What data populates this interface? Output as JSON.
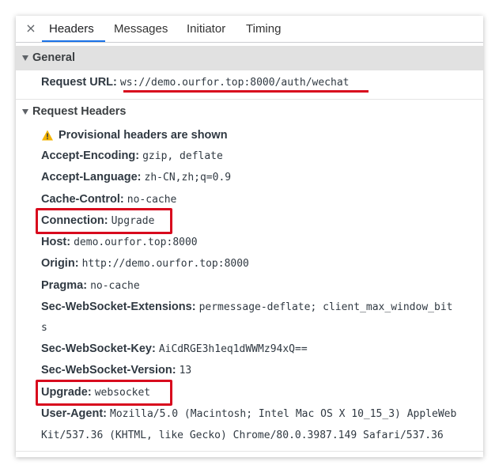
{
  "tabs": [
    {
      "label": "Headers"
    },
    {
      "label": "Messages"
    },
    {
      "label": "Initiator"
    },
    {
      "label": "Timing"
    }
  ],
  "close_symbol": "×",
  "general": {
    "title": "General",
    "request_url_label": "Request URL:",
    "request_url_value": "ws://demo.ourfor.top:8000/auth/wechat"
  },
  "request_headers": {
    "title": "Request Headers",
    "warning": "Provisional headers are shown",
    "warning_icon": "warning-triangle-icon",
    "items": [
      {
        "name": "Accept-Encoding:",
        "value": "gzip, deflate"
      },
      {
        "name": "Accept-Language:",
        "value": "zh-CN,zh;q=0.9"
      },
      {
        "name": "Cache-Control:",
        "value": "no-cache"
      },
      {
        "name": "Connection:",
        "value": "Upgrade"
      },
      {
        "name": "Host:",
        "value": "demo.ourfor.top:8000"
      },
      {
        "name": "Origin:",
        "value": "http://demo.ourfor.top:8000"
      },
      {
        "name": "Pragma:",
        "value": "no-cache"
      },
      {
        "name": "Sec-WebSocket-Extensions:",
        "value": "permessage-deflate; client_max_window_bit",
        "value_cont": "s"
      },
      {
        "name": "Sec-WebSocket-Key:",
        "value": "AiCdRGE3h1eq1dWWMz94xQ=="
      },
      {
        "name": "Sec-WebSocket-Version:",
        "value": "13"
      },
      {
        "name": "Upgrade:",
        "value": "websocket"
      },
      {
        "name": "User-Agent:",
        "value": "Mozilla/5.0 (Macintosh; Intel Mac OS X 10_15_3) AppleWeb",
        "value_cont": "Kit/537.36 (KHTML, like Gecko) Chrome/80.0.3987.149 Safari/537.36"
      }
    ]
  },
  "colors": {
    "highlight": "#d8091d",
    "active_tab": "#1a73e8",
    "section_bg": "#e1e1e1",
    "warning": "#f4b400"
  }
}
